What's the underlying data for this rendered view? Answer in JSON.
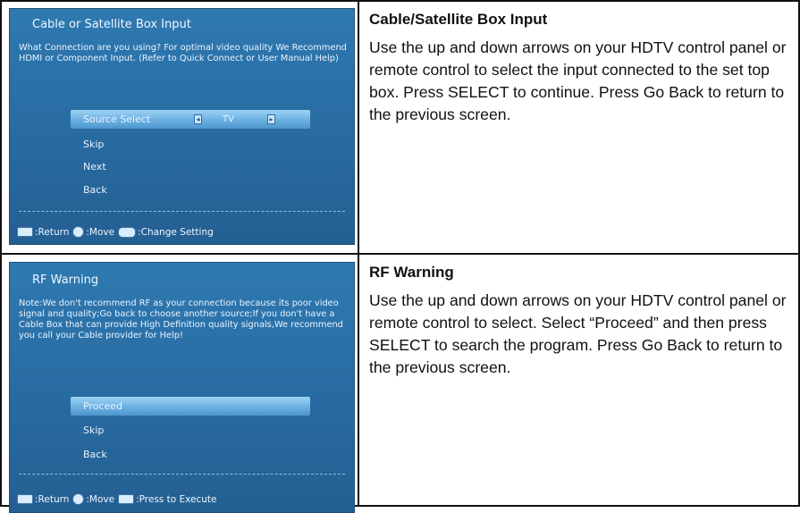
{
  "rows": [
    {
      "screen": {
        "title": "Cable or Satellite Box Input",
        "description": "What Connection are you using? For optimal video quality We Recommend HDMI or Component Input. (Refer to Quick Connect or User Manual Help)",
        "menu": [
          {
            "label": "Source Select",
            "value": "TV",
            "selected": true
          },
          {
            "label": "Skip"
          },
          {
            "label": "Next"
          },
          {
            "label": "Back"
          }
        ],
        "hints": [
          ":Return",
          ":Move",
          ":Change Setting"
        ]
      },
      "heading": "Cable/Satellite Box Input",
      "body": "Use the up and down arrows on your HDTV control panel or remote control to select the input connected to the set top box. Press SELECT to continue. Press Go Back to return to the previous screen."
    },
    {
      "screen": {
        "title": "RF Warning",
        "description": "Note:We don't recommend RF as your connection because its poor video signal and quality;Go back to choose another source;If you don't have a Cable Box that can provide High Definition quality signals,We recommend you call your Cable provider for Help!",
        "menu": [
          {
            "label": "Proceed",
            "selected": true
          },
          {
            "label": "Skip"
          },
          {
            "label": "Back"
          }
        ],
        "hints": [
          ":Return",
          ":Move",
          ":Press to Execute"
        ]
      },
      "heading": "RF Warning",
      "body": "Use the up and down arrows on your HDTV control panel or remote control to select. Select “Proceed” and then press SELECT to search the program. Press Go Back to return to the previous screen."
    }
  ]
}
